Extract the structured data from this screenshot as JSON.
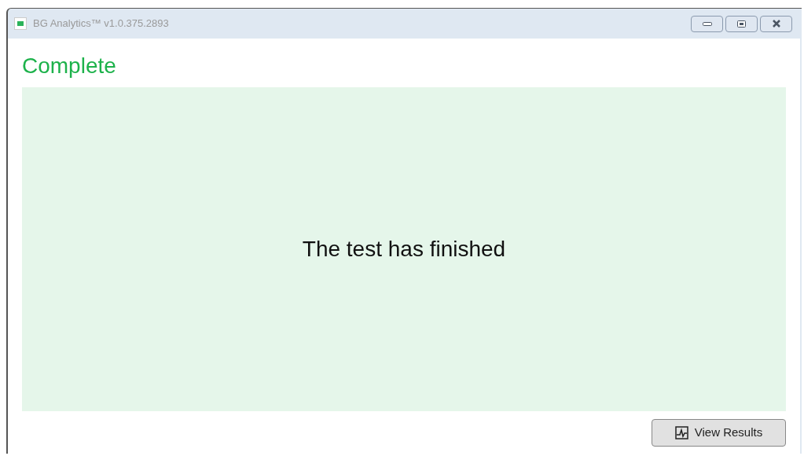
{
  "window": {
    "title": "BG Analytics™ v1.0.375.2893"
  },
  "heading": "Complete",
  "message": "The test has finished",
  "buttons": [
    {
      "label": "View Results"
    }
  ]
}
